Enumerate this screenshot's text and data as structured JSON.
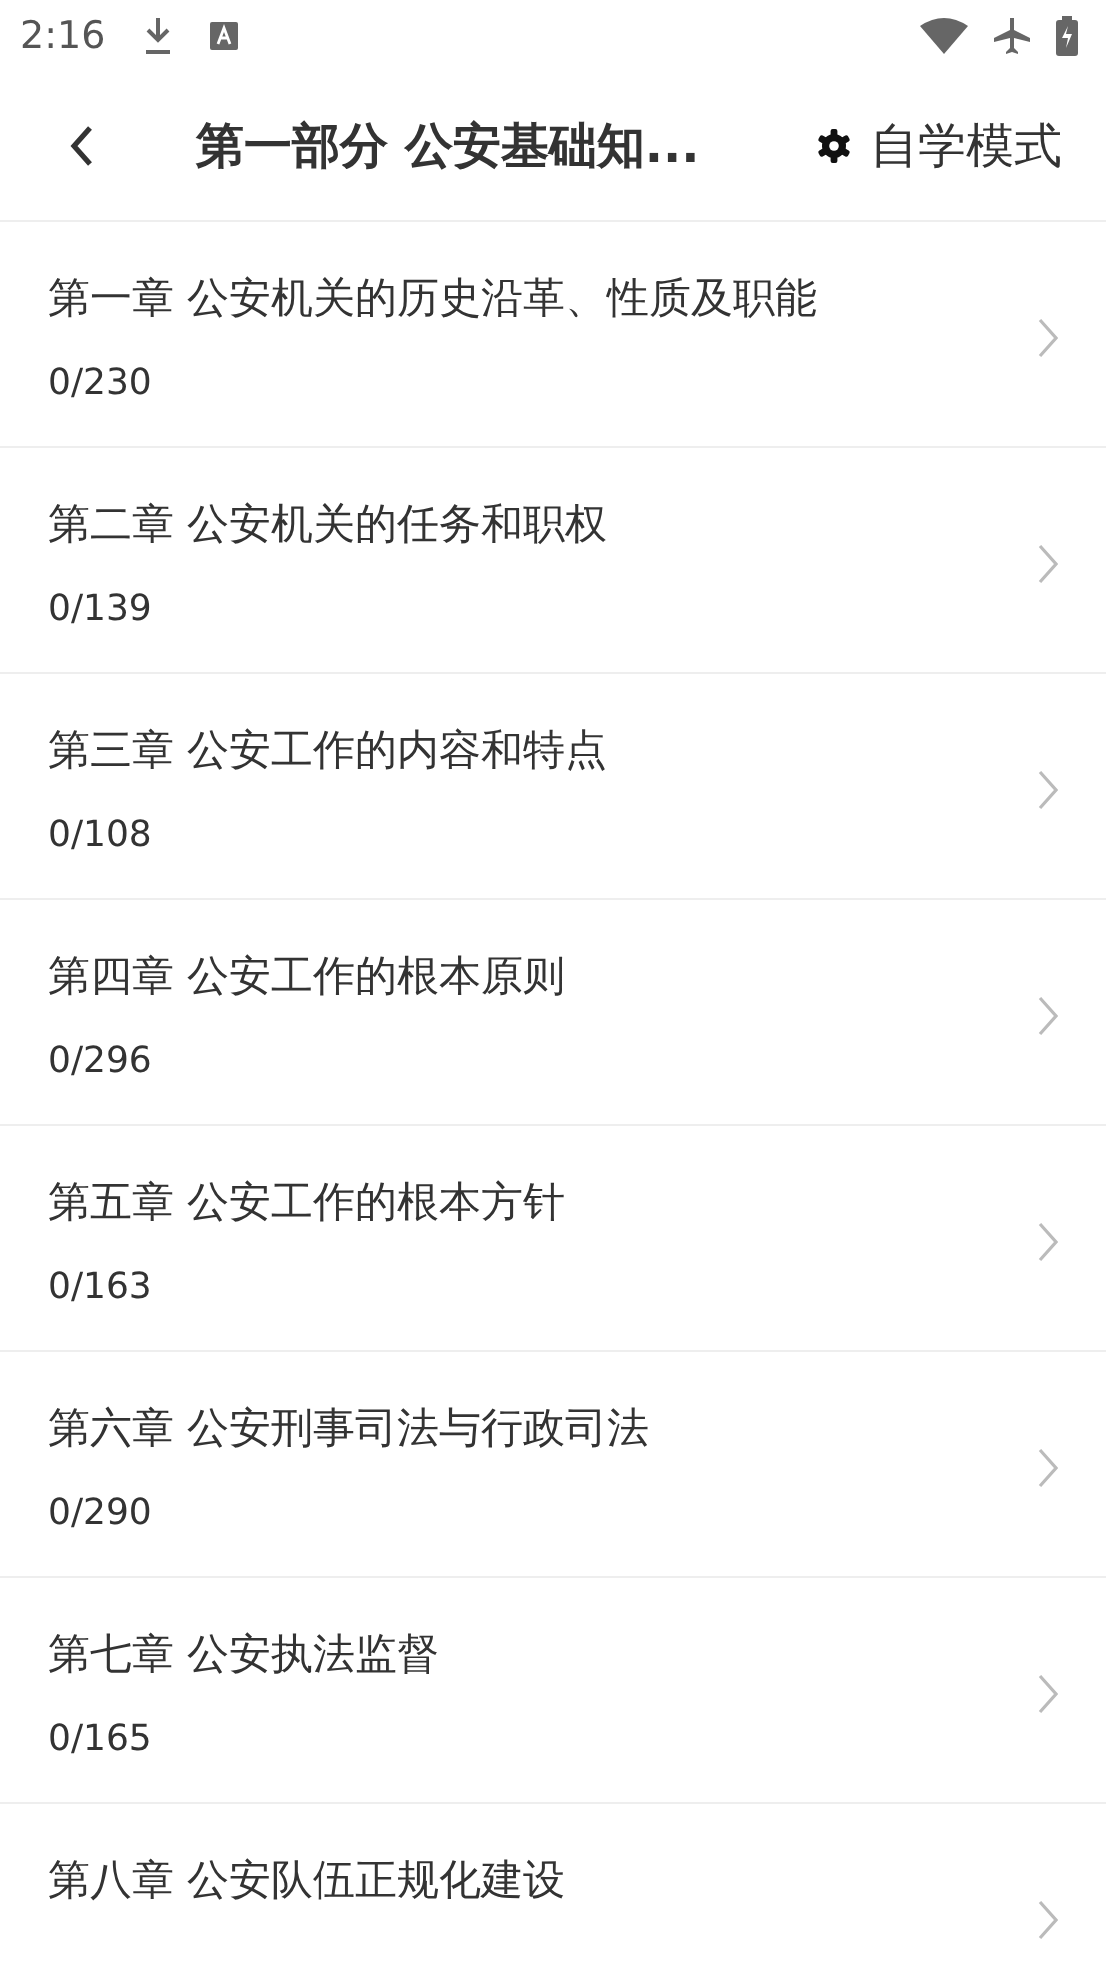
{
  "status_bar": {
    "time": "2:16"
  },
  "header": {
    "title": "第一部分 公安基础知...",
    "mode_label": "自学模式"
  },
  "chapters": [
    {
      "title": "第一章 公安机关的历史沿革、性质及职能",
      "count": "0/230"
    },
    {
      "title": "第二章 公安机关的任务和职权",
      "count": "0/139"
    },
    {
      "title": "第三章 公安工作的内容和特点",
      "count": "0/108"
    },
    {
      "title": "第四章 公安工作的根本原则",
      "count": "0/296"
    },
    {
      "title": "第五章 公安工作的根本方针",
      "count": "0/163"
    },
    {
      "title": "第六章 公安刑事司法与行政司法",
      "count": "0/290"
    },
    {
      "title": "第七章 公安执法监督",
      "count": "0/165"
    },
    {
      "title": "第八章 公安队伍正规化建设"
    }
  ]
}
